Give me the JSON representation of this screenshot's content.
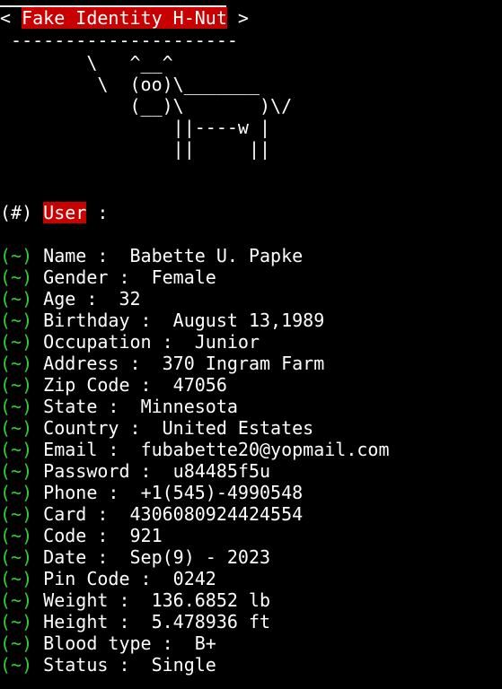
{
  "header": {
    "open_bracket": "<",
    "title": "Fake Identity H-Nut",
    "close_bracket": ">",
    "rule": "---------------------"
  },
  "cow": {
    "ascii": "        \\   ^__^\n         \\  (oo)\\_______\n            (__)\\       )\\/\n                ||----w |\n                ||     ||"
  },
  "user_section": {
    "prefix": "(#)",
    "label": "User",
    "suffix": " :"
  },
  "field_prefix": "(~)",
  "fields": [
    {
      "label": "Name",
      "value": "Babette U. Papke"
    },
    {
      "label": "Gender",
      "value": "Female"
    },
    {
      "label": "Age",
      "value": "32"
    },
    {
      "label": "Birthday",
      "value": "August 13,1989"
    },
    {
      "label": "Occupation",
      "value": "Junior"
    },
    {
      "label": "Address",
      "value": "370 Ingram Farm"
    },
    {
      "label": "Zip Code",
      "value": "47056"
    },
    {
      "label": "State",
      "value": "Minnesota"
    },
    {
      "label": "Country",
      "value": "United Estates"
    },
    {
      "label": "Email",
      "value": "fubabette20@yopmail.com"
    },
    {
      "label": "Password",
      "value": "u84485f5u"
    },
    {
      "label": "Phone",
      "value": "+1(545)-4990548"
    },
    {
      "label": "Card",
      "value": "4306080924424554"
    },
    {
      "label": "Code",
      "value": "921"
    },
    {
      "label": "Date",
      "value": "Sep(9) - 2023"
    },
    {
      "label": "Pin Code",
      "value": "0242"
    },
    {
      "label": "Weight",
      "value": "136.6852 lb"
    },
    {
      "label": "Height",
      "value": "5.478936 ft"
    },
    {
      "label": "Blood type",
      "value": "B+"
    },
    {
      "label": "Status",
      "value": "Single"
    }
  ],
  "colors": {
    "background": "#000000",
    "text": "#ffffff",
    "highlight": "#c80000",
    "prompt_green": "#2fd12f"
  }
}
